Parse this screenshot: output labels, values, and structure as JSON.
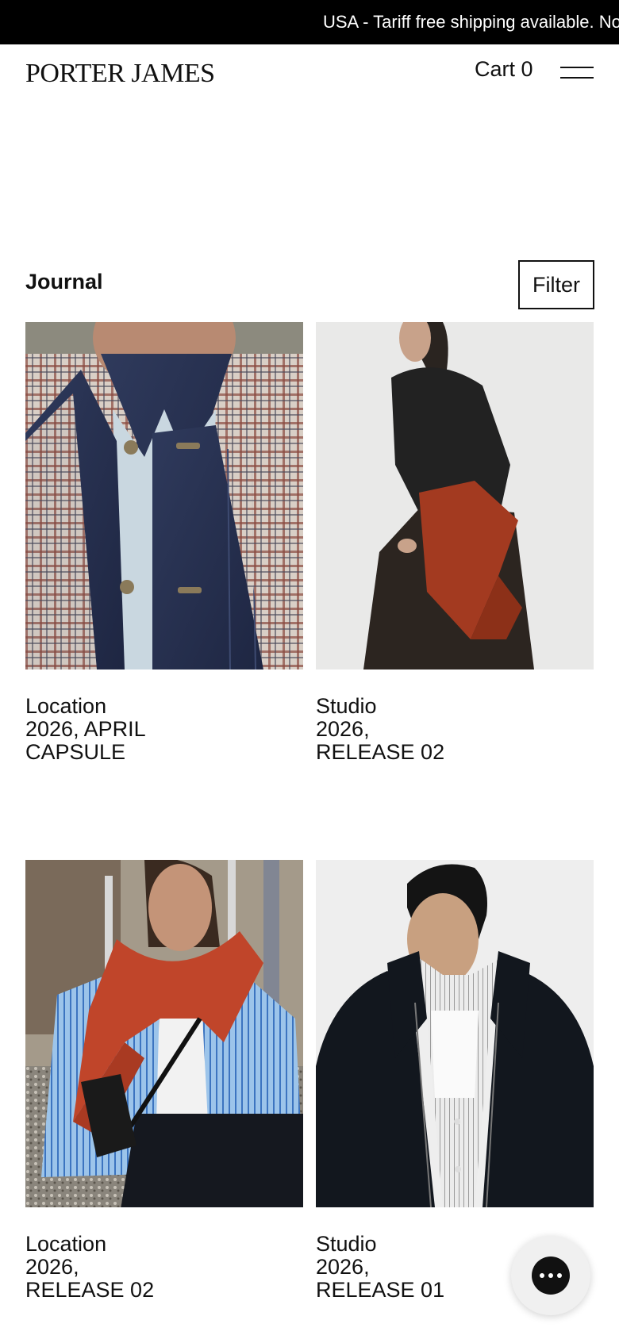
{
  "announcement": {
    "text": "USA - Tariff free shipping available. No"
  },
  "header": {
    "brand": "PORTER JAMES",
    "cart_label": "Cart 0"
  },
  "journal": {
    "title": "Journal",
    "filter_label": "Filter"
  },
  "cards": [
    {
      "category": "Location",
      "line1": "2026, APRIL",
      "line2": "CAPSULE",
      "image": "model-denim-jacket-plaid-coat"
    },
    {
      "category": "Studio",
      "line1": "2026,",
      "line2": "RELEASE 02",
      "image": "model-black-sweater-rust-scarf"
    },
    {
      "category": "Location",
      "line1": "2026,",
      "line2": "RELEASE 02",
      "image": "model-striped-shirt-red-sweater"
    },
    {
      "category": "Studio",
      "line1": "2026,",
      "line2": "RELEASE 01",
      "image": "model-black-jacket-striped-shirt"
    }
  ],
  "colors": {
    "announcement_bg": "#000000",
    "text": "#111111",
    "background": "#ffffff"
  },
  "icons": {
    "menu": "hamburger-icon",
    "chat": "chat-dots-icon"
  }
}
